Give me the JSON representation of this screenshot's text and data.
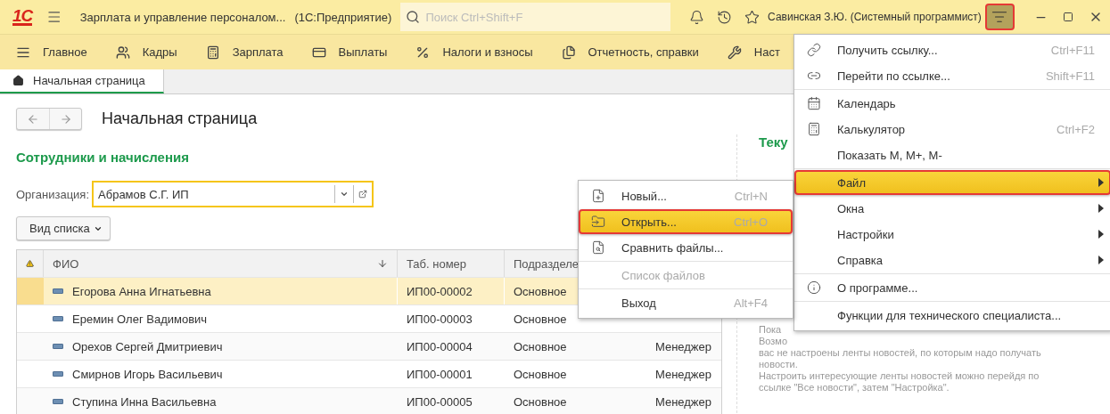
{
  "title_bar": {
    "logo": "1С",
    "title": "Зарплата и управление персоналом...",
    "platform": "(1С:Предприятие)",
    "search": {
      "placeholder": "Поиск Ctrl+Shift+F"
    },
    "user": "Савинская З.Ю. (Системный программист)",
    "menu_button": {
      "selected": true
    }
  },
  "sections": [
    {
      "label": "Главное"
    },
    {
      "label": "Кадры"
    },
    {
      "label": "Зарплата"
    },
    {
      "label": "Выплаты"
    },
    {
      "label": "Налоги и взносы"
    },
    {
      "label": "Отчетность, справки"
    },
    {
      "label": "Наст"
    }
  ],
  "tabs": [
    {
      "label": "Начальная страница",
      "selected": true
    }
  ],
  "page": {
    "title": "Начальная страница",
    "employees": {
      "heading": "Сотрудники и начисления",
      "organization": {
        "label": "Организация:",
        "value": "Абрамов С.Г. ИП"
      },
      "view_button": "Вид списка",
      "table": {
        "columns": [
          {
            "label": "ФИО",
            "sorted": true
          },
          {
            "label": "Таб. номер",
            "sorted": false
          },
          {
            "label": "Подразделе",
            "sorted": false
          }
        ],
        "rows": [
          {
            "name": "Егорова Анна Игнатьевна",
            "tab_number": "ИП00-00002",
            "department": "Основное",
            "selected": true
          },
          {
            "name": "Еремин Олег Вадимович",
            "tab_number": "ИП00-00003",
            "department": "Основное",
            "selected": false
          },
          {
            "name": "Орехов Сергей Дмитриевич",
            "tab_number": "ИП00-00004",
            "department": "Основное",
            "column_4": "Менеджер",
            "selected": false
          },
          {
            "name": "Смирнов Игорь Васильевич",
            "tab_number": "ИП00-00001",
            "department": "Основное",
            "column_4": "Менеджер",
            "selected": false
          },
          {
            "name": "Ступина Инна Васильевна",
            "tab_number": "ИП00-00005",
            "department": "Основное",
            "column_4": "Менеджер",
            "selected": false
          }
        ]
      }
    },
    "news": {
      "heading": "Теку",
      "lines": [
        "Пока",
        "Возмо",
        "вас не настроены ленты новостей, по которым надо получать",
        "новости.",
        "Настроить интересующие ленты новостей можно перейдя по",
        "ссылке \"Все новости\", затем \"Настройка\"."
      ]
    }
  },
  "main_menu": {
    "sections": [
      {
        "items": [
          {
            "label": "Получить ссылку...",
            "shortcut": "Ctrl+F11",
            "selected": false,
            "submenu": false
          },
          {
            "label": "Перейти по ссылке...",
            "shortcut": "Shift+F11",
            "selected": false,
            "submenu": false
          }
        ]
      },
      {
        "items": [
          {
            "label": "Календарь",
            "selected": false,
            "submenu": false
          },
          {
            "label": "Калькулятор",
            "shortcut": "Ctrl+F2",
            "selected": false,
            "submenu": false
          },
          {
            "label": "Показать М, М+, М-",
            "selected": false,
            "submenu": false
          }
        ]
      },
      {
        "items": [
          {
            "label": "Файл",
            "selected": true,
            "submenu": true
          },
          {
            "label": "Окна",
            "selected": false,
            "submenu": true
          },
          {
            "label": "Настройки",
            "selected": false,
            "submenu": true
          },
          {
            "label": "Справка",
            "selected": false,
            "submenu": true
          }
        ]
      },
      {
        "items": [
          {
            "label": "О программе...",
            "selected": false,
            "submenu": false
          }
        ]
      },
      {
        "items": [
          {
            "label": "Функции для технического специалиста...",
            "selected": false,
            "submenu": false
          }
        ]
      }
    ]
  },
  "file_submenu": {
    "sections": [
      {
        "items": [
          {
            "label": "Новый...",
            "shortcut": "Ctrl+N",
            "selected": false,
            "disabled": false
          },
          {
            "label": "Открыть...",
            "shortcut": "Ctrl+O",
            "selected": true,
            "disabled": false
          },
          {
            "label": "Сравнить файлы...",
            "selected": false,
            "disabled": false
          }
        ]
      },
      {
        "items": [
          {
            "label": "Список файлов",
            "selected": false,
            "disabled": true
          }
        ]
      },
      {
        "items": [
          {
            "label": "Выход",
            "shortcut": "Alt+F4",
            "selected": false,
            "disabled": false
          }
        ]
      }
    ]
  }
}
